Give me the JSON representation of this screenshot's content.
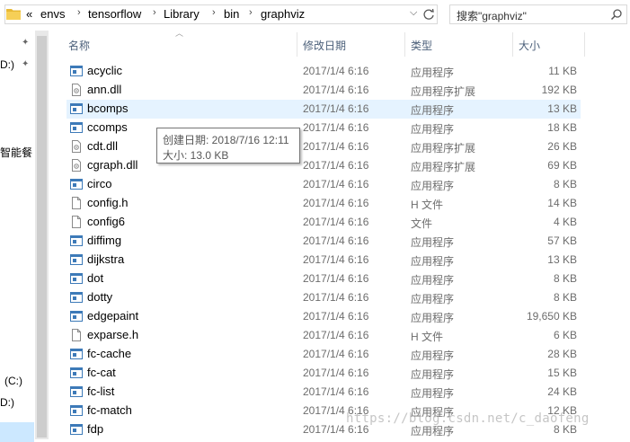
{
  "address": {
    "overflow": "«",
    "crumbs": [
      "envs",
      "tensorflow",
      "Library",
      "bin",
      "graphviz"
    ],
    "dropdown_icon": "chevron-down-icon",
    "refresh_icon": "refresh-icon"
  },
  "search": {
    "placeholder": "搜索\"graphviz\""
  },
  "nav": {
    "items": [
      "D:)",
      "智能餐",
      "(C:)",
      "D:)"
    ]
  },
  "columns": {
    "name": "名称",
    "date": "修改日期",
    "type": "类型",
    "size": "大小"
  },
  "files": [
    {
      "name": "acyclic",
      "date": "2017/1/4 6:16",
      "type": "应用程序",
      "size": "11 KB",
      "icon": "exe"
    },
    {
      "name": "ann.dll",
      "date": "2017/1/4 6:16",
      "type": "应用程序扩展",
      "size": "192 KB",
      "icon": "dll"
    },
    {
      "name": "bcomps",
      "date": "2017/1/4 6:16",
      "type": "应用程序",
      "size": "13 KB",
      "icon": "exe"
    },
    {
      "name": "ccomps",
      "date": "2017/1/4 6:16",
      "type": "应用程序",
      "size": "18 KB",
      "icon": "exe"
    },
    {
      "name": "cdt.dll",
      "date": "2017/1/4 6:16",
      "type": "应用程序扩展",
      "size": "26 KB",
      "icon": "dll"
    },
    {
      "name": "cgraph.dll",
      "date": "2017/1/4 6:16",
      "type": "应用程序扩展",
      "size": "69 KB",
      "icon": "dll"
    },
    {
      "name": "circo",
      "date": "2017/1/4 6:16",
      "type": "应用程序",
      "size": "8 KB",
      "icon": "exe"
    },
    {
      "name": "config.h",
      "date": "2017/1/4 6:16",
      "type": "H 文件",
      "size": "14 KB",
      "icon": "file"
    },
    {
      "name": "config6",
      "date": "2017/1/4 6:16",
      "type": "文件",
      "size": "4 KB",
      "icon": "file"
    },
    {
      "name": "diffimg",
      "date": "2017/1/4 6:16",
      "type": "应用程序",
      "size": "57 KB",
      "icon": "exe"
    },
    {
      "name": "dijkstra",
      "date": "2017/1/4 6:16",
      "type": "应用程序",
      "size": "13 KB",
      "icon": "exe"
    },
    {
      "name": "dot",
      "date": "2017/1/4 6:16",
      "type": "应用程序",
      "size": "8 KB",
      "icon": "exe"
    },
    {
      "name": "dotty",
      "date": "2017/1/4 6:16",
      "type": "应用程序",
      "size": "8 KB",
      "icon": "exe"
    },
    {
      "name": "edgepaint",
      "date": "2017/1/4 6:16",
      "type": "应用程序",
      "size": "19,650 KB",
      "icon": "exe"
    },
    {
      "name": "exparse.h",
      "date": "2017/1/4 6:16",
      "type": "H 文件",
      "size": "6 KB",
      "icon": "file"
    },
    {
      "name": "fc-cache",
      "date": "2017/1/4 6:16",
      "type": "应用程序",
      "size": "28 KB",
      "icon": "exe"
    },
    {
      "name": "fc-cat",
      "date": "2017/1/4 6:16",
      "type": "应用程序",
      "size": "15 KB",
      "icon": "exe"
    },
    {
      "name": "fc-list",
      "date": "2017/1/4 6:16",
      "type": "应用程序",
      "size": "24 KB",
      "icon": "exe"
    },
    {
      "name": "fc-match",
      "date": "2017/1/4 6:16",
      "type": "应用程序",
      "size": "12 KB",
      "icon": "exe"
    },
    {
      "name": "fdp",
      "date": "2017/1/4 6:16",
      "type": "应用程序",
      "size": "8 KB",
      "icon": "exe"
    }
  ],
  "selected_index": 2,
  "tooltip": {
    "line1": "创建日期: 2018/7/16 12:11",
    "line2": "大小: 13.0 KB"
  },
  "watermark": "https://blog.csdn.net/c_daofeng",
  "colors": {
    "selection": "#e5f3ff",
    "nav_selection": "#cce8ff",
    "header_text": "#4c607a"
  }
}
